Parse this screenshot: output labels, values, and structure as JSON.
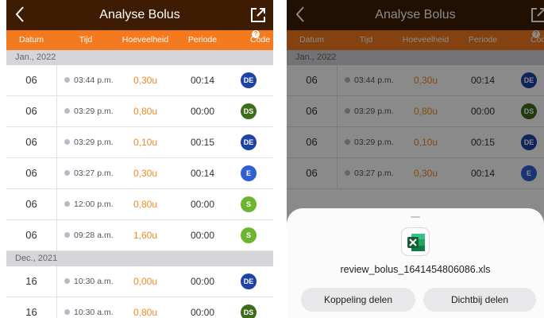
{
  "header": {
    "title": "Analyse Bolus"
  },
  "columns": {
    "date": "Datum",
    "time": "Tijd",
    "amount": "Hoeveelheid",
    "period": "Periode",
    "code": "Code"
  },
  "colors": {
    "appbar": "#3d1c03",
    "header": "#f47a1f",
    "amount_text": "#f08a1e",
    "DE": "#1c43a8",
    "DS": "#3e6d1a",
    "E": "#2f5fd6",
    "S": "#6cb52f"
  },
  "left": {
    "sections": [
      {
        "label": "Jan., 2022",
        "rows": [
          {
            "day": "06",
            "time": "03:44 p.m.",
            "amount": "0,30u",
            "period": "00:14",
            "code": "DE"
          },
          {
            "day": "06",
            "time": "03:29 p.m.",
            "amount": "0,80u",
            "period": "00:00",
            "code": "DS"
          },
          {
            "day": "06",
            "time": "03:29 p.m.",
            "amount": "0,10u",
            "period": "00:15",
            "code": "DE"
          },
          {
            "day": "06",
            "time": "03:27 p.m.",
            "amount": "0,30u",
            "period": "00:14",
            "code": "E"
          },
          {
            "day": "06",
            "time": "12:00 p.m.",
            "amount": "0,80u",
            "period": "00:00",
            "code": "S"
          },
          {
            "day": "06",
            "time": "09:28 a.m.",
            "amount": "1,60u",
            "period": "00:00",
            "code": "S"
          }
        ]
      },
      {
        "label": "Dec., 2021",
        "rows": [
          {
            "day": "16",
            "time": "10:30 a.m.",
            "amount": "0,00u",
            "period": "00:00",
            "code": "DE"
          },
          {
            "day": "16",
            "time": "10:30 a.m.",
            "amount": "0,80u",
            "period": "00:00",
            "code": "DS"
          }
        ]
      }
    ]
  },
  "right": {
    "sections": [
      {
        "label": "Jan., 2022",
        "rows": [
          {
            "day": "06",
            "time": "03:44 p.m.",
            "amount": "0,30u",
            "period": "00:14",
            "code": "DE"
          },
          {
            "day": "06",
            "time": "03:29 p.m.",
            "amount": "0,80u",
            "period": "00:00",
            "code": "DS"
          },
          {
            "day": "06",
            "time": "03:29 p.m.",
            "amount": "0,10u",
            "period": "00:15",
            "code": "DE"
          },
          {
            "day": "06",
            "time": "03:27 p.m.",
            "amount": "0,30u",
            "period": "00:14",
            "code": "E"
          }
        ]
      }
    ]
  },
  "share_sheet": {
    "file_icon": "excel-icon",
    "filename": "review_bolus_1641454806086.xls",
    "link_share_label": "Koppeling delen",
    "nearby_share_label": "Dichtbij delen"
  }
}
